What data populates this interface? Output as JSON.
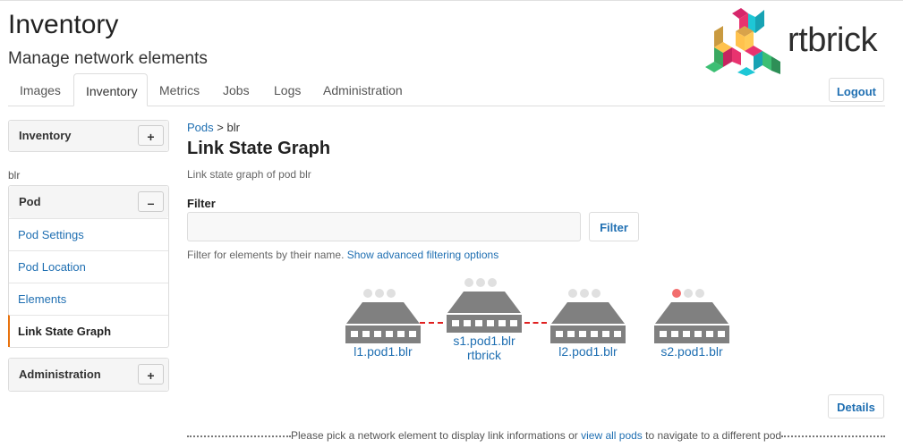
{
  "header": {
    "title": "Inventory",
    "subtitle": "Manage network elements",
    "logo_text": "rtbrick",
    "logout_label": "Logout"
  },
  "tabs": [
    {
      "label": "Images",
      "active": false
    },
    {
      "label": "Inventory",
      "active": true
    },
    {
      "label": "Metrics",
      "active": false
    },
    {
      "label": "Jobs",
      "active": false
    },
    {
      "label": "Logs",
      "active": false
    },
    {
      "label": "Administration",
      "active": false
    }
  ],
  "sidebar": {
    "inventory_panel": {
      "title": "Inventory",
      "toggle": "+"
    },
    "pod_name": "blr",
    "pod_panel": {
      "title": "Pod",
      "toggle": "–",
      "items": [
        {
          "label": "Pod Settings",
          "active": false
        },
        {
          "label": "Pod Location",
          "active": false
        },
        {
          "label": "Elements",
          "active": false
        },
        {
          "label": "Link State Graph",
          "active": true
        }
      ]
    },
    "administration_panel": {
      "title": "Administration",
      "toggle": "+"
    }
  },
  "main": {
    "breadcrumb": {
      "link": "Pods",
      "separator": ">",
      "current": "blr"
    },
    "title": "Link State Graph",
    "description": "Link state graph of pod blr",
    "filter": {
      "label": "Filter",
      "value": "",
      "placeholder": "",
      "button_label": "Filter",
      "help_text": "Filter for elements by their name.",
      "help_link": "Show advanced filtering options"
    },
    "graph": {
      "nodes": [
        {
          "name": "l1.pod1.blr",
          "sublabel": "",
          "status_lights": [
            "off",
            "off",
            "off"
          ]
        },
        {
          "name": "s1.pod1.blr",
          "sublabel": "rtbrick",
          "status_lights": [
            "off",
            "off",
            "off"
          ]
        },
        {
          "name": "l2.pod1.blr",
          "sublabel": "",
          "status_lights": [
            "off",
            "off",
            "off"
          ]
        },
        {
          "name": "s2.pod1.blr",
          "sublabel": "",
          "status_lights": [
            "red",
            "off",
            "off"
          ]
        }
      ],
      "links": [
        {
          "from": "l1.pod1.blr",
          "to": "s1.pod1.blr",
          "status": "down"
        },
        {
          "from": "s1.pod1.blr",
          "to": "l2.pod1.blr",
          "status": "down"
        }
      ],
      "colors": {
        "device": "#808080",
        "light_off": "#e0e0e0",
        "light_red": "#f26d6d",
        "link_down": "#e02020"
      }
    },
    "details_label": "Details",
    "footer": {
      "before": "Please pick a network element to display link informations or",
      "link": "view all pods",
      "after": "to navigate to a different pod"
    }
  },
  "colors": {
    "accent": "#1f6fb2",
    "active_marker": "#e8730e"
  }
}
